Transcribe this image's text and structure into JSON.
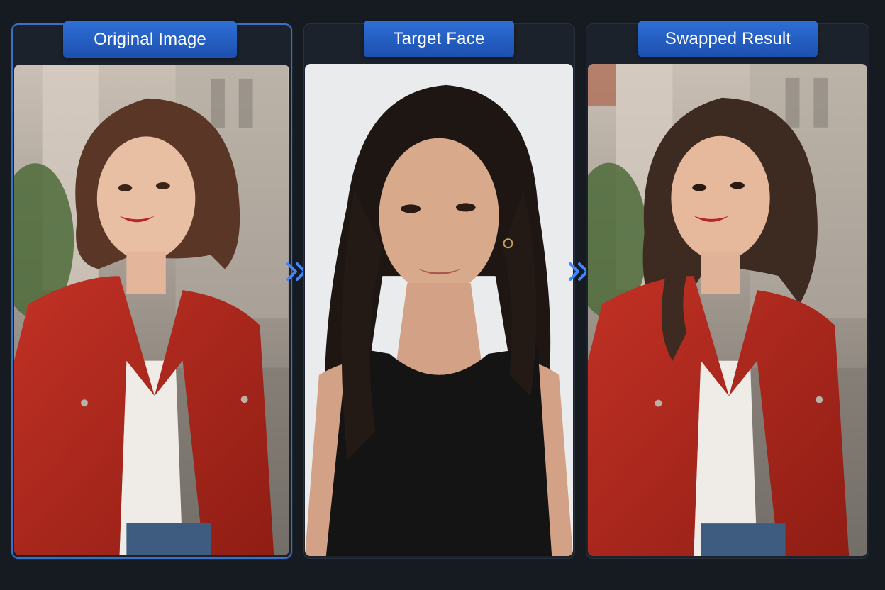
{
  "panels": {
    "original": {
      "label": "Original Image"
    },
    "target": {
      "label": "Target Face"
    },
    "result": {
      "label": "Swapped Result"
    }
  },
  "icons": {
    "arrow_1": "double-chevron-right-icon",
    "arrow_2": "double-chevron-right-icon"
  },
  "colors": {
    "background": "#161b22",
    "label_blue": "#2f6fd6",
    "active_border": "#3a70c8",
    "jacket_red": "#b8281e",
    "arrow_blue": "#3f86ff"
  }
}
